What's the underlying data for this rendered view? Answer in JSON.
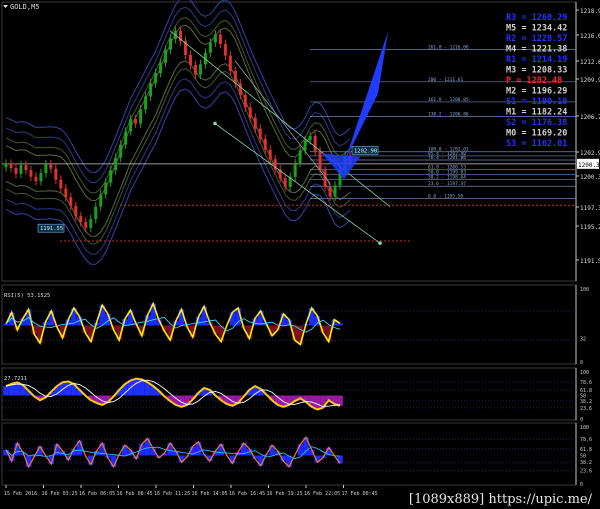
{
  "window": {
    "symbol": "GOLD,M5"
  },
  "colors": {
    "background": "#000000",
    "grid": "#1f2a3a",
    "axis": "#c8c8c8",
    "bull": "#1aa31a",
    "bear": "#e03030",
    "pivot_blue": "#2233ff",
    "pivot_red": "#ff2020",
    "pivot_dark": "#d0d0d0",
    "fib": "#6f86b3"
  },
  "chart_data": [
    {
      "type": "line",
      "name": "main-price-panel",
      "ylim": [
        1185,
        1222
      ],
      "y_ticks": [
        "1218.95",
        "1216.05",
        "1212.60",
        "1209.95",
        "1206.75",
        "1202.90",
        "1200.37",
        "1197.35",
        "1195.25",
        "1191.55"
      ],
      "price_marker": "1200.37",
      "low_box_label": "1191.55",
      "high_box_label": "1202.90",
      "series": [
        {
          "values": [
            1200.4,
            1199.8,
            1199.0,
            1200.2,
            1199.5,
            1198.6,
            1198.0,
            1199.1,
            1200.3,
            1199.7,
            1198.2,
            1197.0,
            1195.8,
            1194.6,
            1193.2,
            1192.4,
            1191.6,
            1192.8,
            1194.5,
            1196.2,
            1197.8,
            1199.5,
            1201.2,
            1203.0,
            1204.8,
            1206.5,
            1205.9,
            1207.8,
            1209.6,
            1211.4,
            1212.8,
            1214.2,
            1216.0,
            1217.5,
            1218.6,
            1217.2,
            1215.3,
            1213.9,
            1212.6,
            1214.0,
            1215.6,
            1217.0,
            1218.1,
            1216.8,
            1215.2,
            1213.1,
            1211.4,
            1209.8,
            1208.1,
            1206.7,
            1205.2,
            1203.8,
            1202.3,
            1201.0,
            1199.6,
            1198.4,
            1197.2,
            1198.6,
            1200.5,
            1202.2,
            1203.6,
            1204.2,
            1202.1,
            1199.5,
            1197.2,
            1195.9,
            1197.4,
            1199.6,
            1201.4,
            1200.4
          ]
        }
      ],
      "fib_levels": [
        {
          "label": "261.8 - 1216.06",
          "value": 1216.06
        },
        {
          "label": "200 - 1211.61",
          "value": 1211.61
        },
        {
          "label": "161.8 - 1208.85",
          "value": 1208.85
        },
        {
          "label": "138.2 - 1206.86",
          "value": 1206.86
        },
        {
          "label": "100.0 - 1202.03",
          "value": 1202.03
        },
        {
          "label": "85.4 - 1202.40",
          "value": 1201.45
        },
        {
          "label": "76.4 - 1201.86",
          "value": 1200.9
        },
        {
          "label": "61.8 - 1200.53",
          "value": 1199.6
        },
        {
          "label": "50.0 - 1199.03",
          "value": 1198.9
        },
        {
          "label": "38.2 - 1198.64",
          "value": 1198.2
        },
        {
          "label": "23.6 - 1197.47",
          "value": 1197.3
        },
        {
          "label": "0.0 - 1195.50",
          "value": 1195.6
        }
      ],
      "pivots": [
        {
          "label": "R3 = 1260.29",
          "color": "#2233ff"
        },
        {
          "label": "M5 = 1234.42",
          "color": "#d0d0d0"
        },
        {
          "label": "R2 = 1228.57",
          "color": "#2233ff"
        },
        {
          "label": "M4 = 1221.38",
          "color": "#d0d0d0"
        },
        {
          "label": "R1 = 1214.19",
          "color": "#2233ff"
        },
        {
          "label": "M3 = 1208.33",
          "color": "#d0d0d0"
        },
        {
          "label": "P   = 1202.48",
          "color": "#ff2020"
        },
        {
          "label": "M2 = 1196.29",
          "color": "#d0d0d0"
        },
        {
          "label": "S1 = 1190.10",
          "color": "#2233ff"
        },
        {
          "label": "M1 = 1182.24",
          "color": "#d0d0d0"
        },
        {
          "label": "S2 = 1176.38",
          "color": "#2233ff"
        },
        {
          "label": "M0 = 1169.20",
          "color": "#d0d0d0"
        },
        {
          "label": "S3 = 1162.01",
          "color": "#2233ff"
        }
      ]
    },
    {
      "type": "line",
      "name": "rsi-panel",
      "label": "RSI(5) 53.1525",
      "ylim": [
        0,
        100
      ],
      "y_ticks": [
        "100",
        "32",
        "0"
      ],
      "series": [
        {
          "values": [
            52,
            68,
            44,
            60,
            72,
            38,
            26,
            55,
            70,
            48,
            33,
            58,
            74,
            62,
            40,
            28,
            54,
            78,
            66,
            44,
            30,
            59,
            71,
            52,
            36,
            64,
            80,
            58,
            42,
            30,
            56,
            72,
            48,
            34,
            62,
            76,
            54,
            38,
            28,
            50,
            68,
            74,
            46,
            32,
            60,
            70,
            52,
            36,
            44,
            66,
            58,
            30,
            24,
            52,
            74,
            63,
            40,
            28,
            58,
            53
          ]
        }
      ]
    },
    {
      "type": "line",
      "name": "stoch-panel",
      "label": "27.7211",
      "ylim": [
        0,
        100
      ],
      "y_ticks": [
        "100",
        "78.6",
        "61.8",
        "50",
        "38.2",
        "23.6",
        "0"
      ],
      "series": [
        {
          "values": [
            70,
            75,
            78,
            72,
            60,
            48,
            40,
            46,
            58,
            70,
            78,
            80,
            74,
            62,
            50,
            40,
            34,
            30,
            36,
            48,
            62,
            74,
            82,
            86,
            84,
            78,
            70,
            60,
            48,
            38,
            30,
            26,
            30,
            42,
            56,
            66,
            62,
            50,
            40,
            32,
            28,
            34,
            48,
            62,
            70,
            64,
            52,
            40,
            30,
            26,
            30,
            38,
            44,
            36,
            26,
            20,
            24,
            40,
            32,
            28
          ]
        }
      ]
    },
    {
      "type": "line",
      "name": "oscillator-panel",
      "ylim": [
        0,
        100
      ],
      "y_ticks": [
        "100",
        "78.6",
        "61.8",
        "50",
        "38.2",
        "23.6",
        "0"
      ],
      "series": [
        {
          "values": [
            60,
            40,
            72,
            55,
            30,
            48,
            66,
            50,
            35,
            70,
            58,
            42,
            62,
            76,
            50,
            34,
            58,
            72,
            46,
            30,
            52,
            68,
            60,
            44,
            70,
            80,
            62,
            46,
            54,
            72,
            58,
            38,
            48,
            66,
            74,
            52,
            40,
            58,
            70,
            50,
            36,
            56,
            72,
            62,
            44,
            32,
            52,
            68,
            58,
            40,
            30,
            50,
            70,
            82,
            60,
            38,
            46,
            64,
            50,
            36
          ]
        }
      ],
      "x_ticks": [
        "15 Feb 2016",
        "16 Feb 03:25",
        "16 Feb 06:05",
        "16 Feb 08:45",
        "16 Feb 11:25",
        "16 Feb 14:05",
        "16 Feb 16:45",
        "16 Feb 19:25",
        "16 Feb 22:05",
        "17 Feb 00:45"
      ]
    }
  ],
  "watermark": "[1089x889] https://upic.me/"
}
